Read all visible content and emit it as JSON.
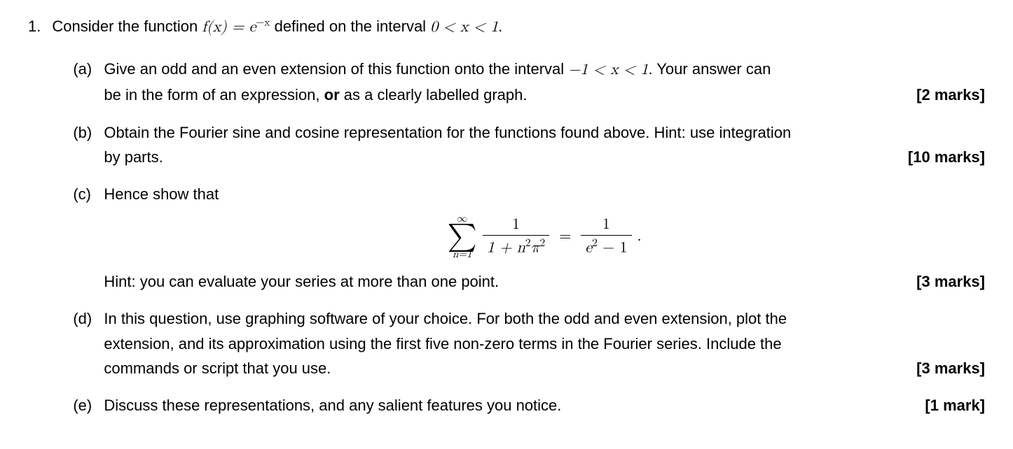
{
  "problem": {
    "number": "1.",
    "intro_pre": "Consider the function ",
    "intro_fn_left": "f(x) = e",
    "intro_fn_exp": "−x",
    "intro_mid": " defined on the interval ",
    "intro_interval": "0 < x < 1",
    "intro_end": "."
  },
  "parts": {
    "a": {
      "label": "(a)",
      "line1_pre": "Give an odd and an even extension of this function onto the interval ",
      "line1_interval": "−1 < x < 1",
      "line1_post": ". Your answer can",
      "line2_pre": "be in the form of an expression, ",
      "line2_bold": "or",
      "line2_post": " as a clearly labelled graph.",
      "marks": "[2 marks]"
    },
    "b": {
      "label": "(b)",
      "line1": "Obtain the Fourier sine and cosine representation for the functions found above. Hint: use integration",
      "line2": "by parts.",
      "marks": "[10 marks]"
    },
    "c": {
      "label": "(c)",
      "intro": "Hence show that",
      "sum_top": "∞",
      "sum_bot": "n=1",
      "frac1_num": "1",
      "frac1_den_pre": "1 + n",
      "frac1_den_exp1": "2",
      "frac1_den_pi": "π",
      "frac1_den_exp2": "2",
      "equals": "=",
      "frac2_num": "1",
      "frac2_den_e": "e",
      "frac2_den_exp": "2",
      "frac2_den_post": " − 1",
      "period": ".",
      "hint": "Hint: you can evaluate your series at more than one point.",
      "marks": "[3 marks]"
    },
    "d": {
      "label": "(d)",
      "line1": "In this question, use graphing software of your choice. For both the odd and even extension, plot the",
      "line2": "extension, and its approximation using the first five non-zero terms in the Fourier series. Include the",
      "line3": "commands or script that you use.",
      "marks": "[3 marks]"
    },
    "e": {
      "label": "(e)",
      "text": "Discuss these representations, and any salient features you notice.",
      "marks": "[1 mark]"
    }
  }
}
